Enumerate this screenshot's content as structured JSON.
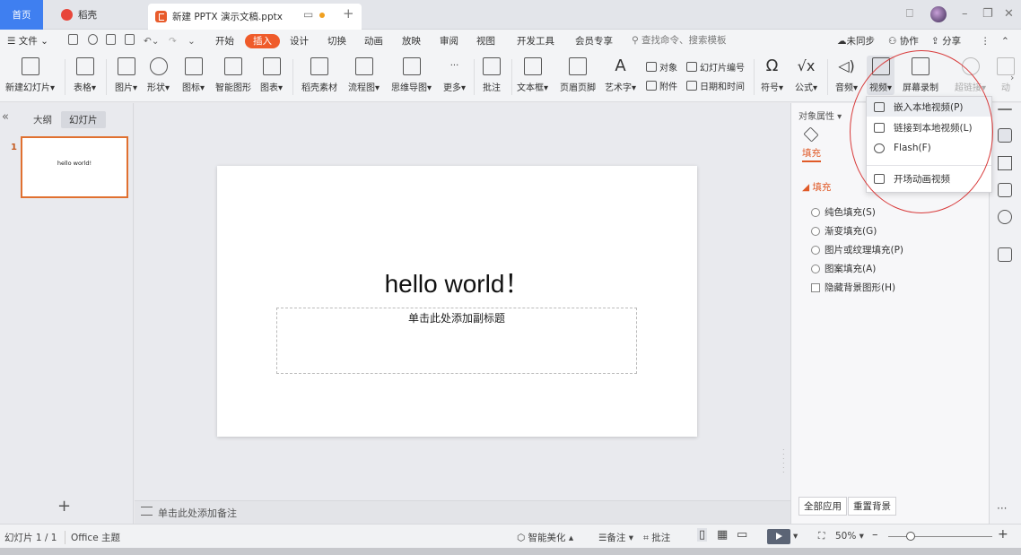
{
  "tabs": {
    "home": "首页",
    "docer": "稻壳",
    "file": "新建 PPTX 演示文稿.pptx"
  },
  "menu": {
    "file": "文件",
    "items": [
      "开始",
      "插入",
      "设计",
      "切换",
      "动画",
      "放映",
      "审阅",
      "视图",
      "开发工具",
      "会员专享"
    ],
    "search_placeholder": "查找命令、搜索模板",
    "sync": "未同步",
    "collab": "协作",
    "share": "分享"
  },
  "ribbon": {
    "new_slide": "新建幻灯片",
    "table": "表格",
    "picture": "图片",
    "shape": "形状",
    "icon": "图标",
    "smart_graphic": "智能图形",
    "chart": "图表",
    "docer_material": "稻壳素材",
    "flowchart": "流程图",
    "mindmap": "思维导图",
    "more": "更多",
    "comment": "批注",
    "textbox": "文本框",
    "header_footer": "页眉页脚",
    "wordart": "艺术字",
    "object": "对象",
    "slide_number": "幻灯片编号",
    "attachment": "附件",
    "datetime": "日期和时间",
    "symbol": "符号",
    "formula": "公式",
    "audio": "音频",
    "video": "视频",
    "screen_record": "屏幕录制",
    "hyperlink": "超链接",
    "animation": "动"
  },
  "left_panel": {
    "tab_outline": "大纲",
    "tab_slides": "幻灯片",
    "slide_number": "1",
    "thumb_text": "hello world!"
  },
  "slide": {
    "title": "hello world！",
    "subtitle_placeholder": "单击此处添加副标题"
  },
  "notes": {
    "placeholder": "单击此处添加备注"
  },
  "property_pane": {
    "title": "对象属性",
    "fill_tab": "填充",
    "section": "填充",
    "options": [
      "纯色填充(S)",
      "渐变填充(G)",
      "图片或纹理填充(P)",
      "图案填充(A)"
    ],
    "hide_bg": "隐藏背景图形(H)",
    "apply_all": "全部应用",
    "reset_bg": "重置背景"
  },
  "video_menu": {
    "items": [
      "嵌入本地视频(P)",
      "链接到本地视频(L)",
      "Flash(F)",
      "开场动画视频"
    ]
  },
  "status": {
    "slide_info": "幻灯片 1 / 1",
    "theme": "Office 主题",
    "beautify": "智能美化",
    "notes": "备注",
    "comment": "批注",
    "zoom": "50%"
  },
  "colors": {
    "accent": "#ef5b2a",
    "home_tab": "#3f7ff0",
    "annotation_circle": "#d83a3a"
  }
}
